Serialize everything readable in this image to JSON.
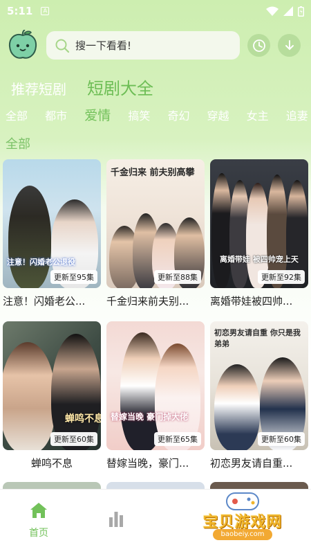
{
  "status_bar": {
    "time": "5:11",
    "notification_letter": "A"
  },
  "search": {
    "placeholder": "搜一下看看!"
  },
  "tabs": [
    {
      "label": "推荐短剧",
      "active": false
    },
    {
      "label": "短剧大全",
      "active": true
    }
  ],
  "categories": [
    "全部",
    "都市",
    "爱情",
    "搞笑",
    "奇幻",
    "穿越",
    "女主",
    "追妻"
  ],
  "active_category": "爱情",
  "section_title": "全部",
  "dramas": [
    {
      "title": "注意！闪婚老公...",
      "badge": "更新至95集",
      "poster_caption": "注意！闪婚老公退役"
    },
    {
      "title": "千金归来前夫别...",
      "badge": "更新至88集",
      "poster_caption": "千金归来 前夫别高攀"
    },
    {
      "title": "离婚带娃被四帅...",
      "badge": "更新至92集",
      "poster_caption": "离婚带娃 被四帅宠上天"
    },
    {
      "title": "蝉鸣不息",
      "badge": "更新至60集",
      "poster_caption": "蝉鸣不息"
    },
    {
      "title": "替嫁当晚，豪门...",
      "badge": "更新至65集",
      "poster_caption": "替嫁当晚 豪门掉大佬"
    },
    {
      "title": "初恋男友请自重...",
      "badge": "更新至60集",
      "poster_caption": "初恋男友请自重 你只是我弟弟"
    }
  ],
  "bottom_nav": {
    "home_label": "首页"
  },
  "watermark": {
    "text": "宝贝游戏网",
    "url": "baobeiy.com"
  },
  "colors": {
    "accent": "#72c15a",
    "background_top": "#cdeeb0",
    "card_badge_bg": "#ffffff"
  }
}
